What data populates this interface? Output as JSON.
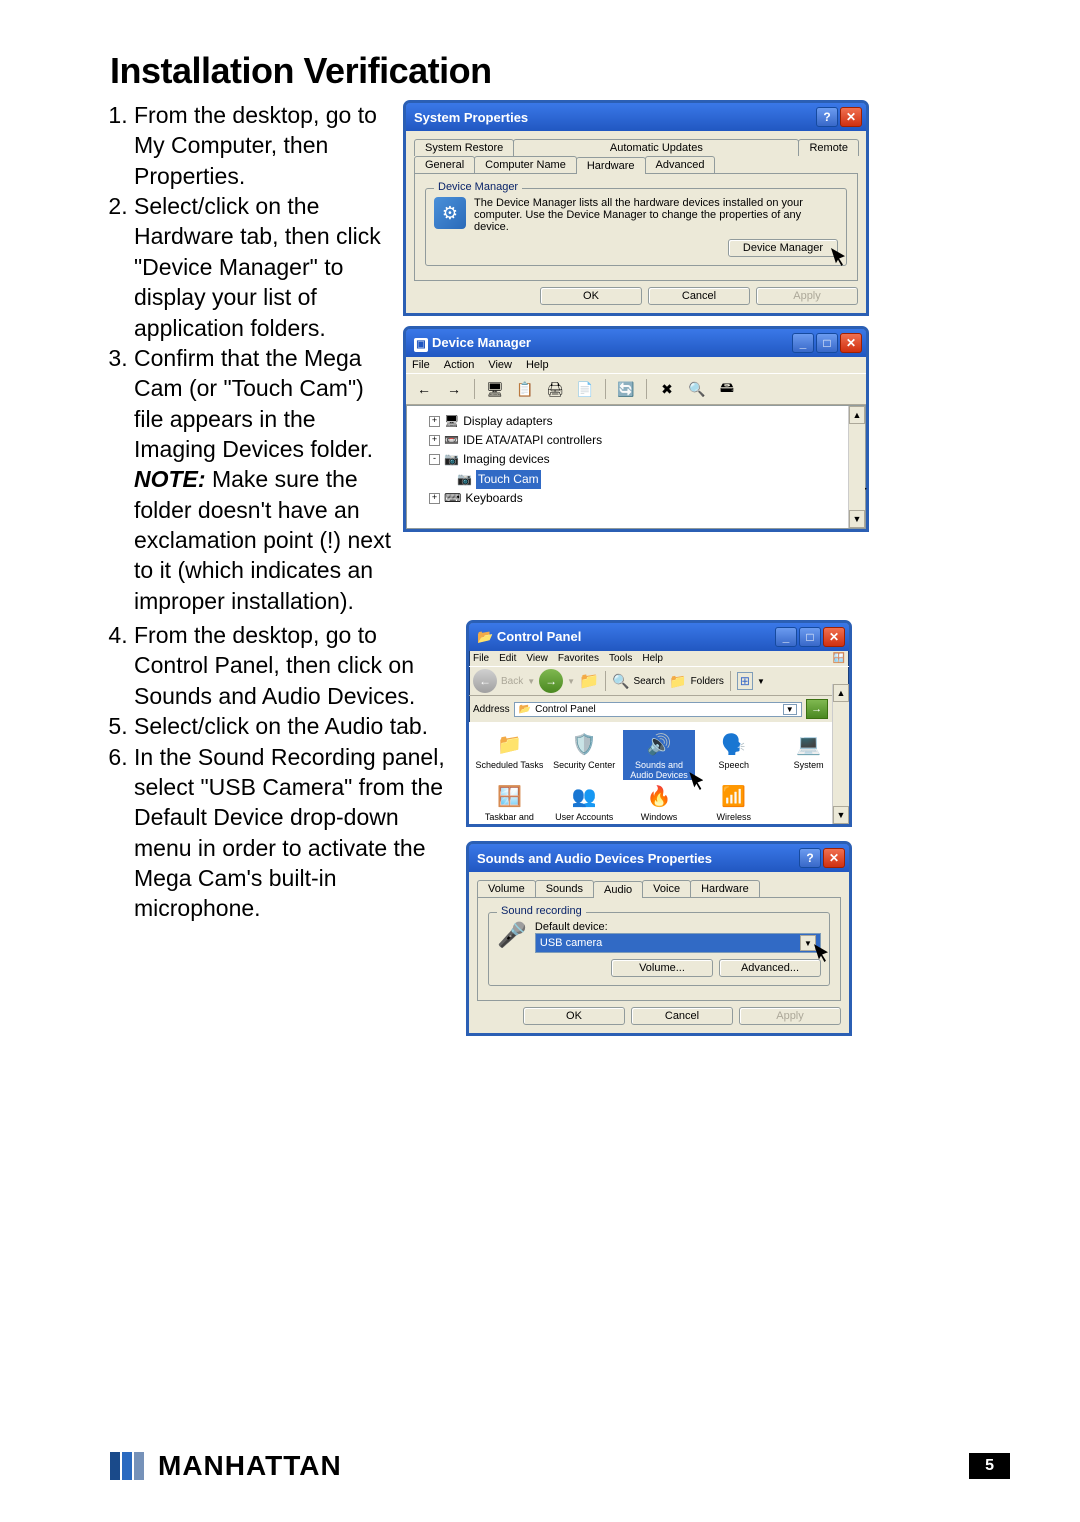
{
  "heading": "Installation Verification",
  "steps": [
    "From the desktop, go to My Computer, then Properties.",
    "Select/click on the Hardware tab, then click \"Device Manager\" to display your list of application folders.",
    "Confirm that the Mega Cam (or \"Touch Cam\") file appears in the Imaging Devices folder. ",
    "From the desktop, go to Control Panel, then click on Sounds and Audio Devices.",
    "Select/click on the Audio tab.",
    "In the Sound Recording panel, select \"USB Camera\" from the Default Device drop-down menu in order to activate the Mega Cam's built-in microphone."
  ],
  "note_label": "NOTE:",
  "note_text": " Make sure the folder doesn't have an exclamation point (!) next to it (which indicates an improper installation).",
  "sysprops": {
    "title": "System Properties",
    "tabs_top": [
      "System Restore",
      "Automatic Updates",
      "Remote"
    ],
    "tabs_bottom": [
      "General",
      "Computer Name",
      "Hardware",
      "Advanced"
    ],
    "active_tab": "Hardware",
    "group_title": "Device Manager",
    "group_text": "The Device Manager lists all the hardware devices installed on your computer. Use the Device Manager to change the properties of any device.",
    "dm_button": "Device Manager",
    "ok": "OK",
    "cancel": "Cancel",
    "apply": "Apply"
  },
  "devmgr": {
    "title": "Device Manager",
    "menu": [
      "File",
      "Action",
      "View",
      "Help"
    ],
    "tree": [
      {
        "indent": 1,
        "expand": "+",
        "label": "Display adapters"
      },
      {
        "indent": 1,
        "expand": "+",
        "label": "IDE ATA/ATAPI controllers"
      },
      {
        "indent": 1,
        "expand": "-",
        "label": "Imaging devices"
      },
      {
        "indent": 2,
        "expand": "",
        "label": "Touch Cam",
        "selected": true
      },
      {
        "indent": 1,
        "expand": "+",
        "label": "Keyboards"
      }
    ]
  },
  "cpanel": {
    "title": "Control Panel",
    "menu": [
      "File",
      "Edit",
      "View",
      "Favorites",
      "Tools",
      "Help"
    ],
    "back": "Back",
    "search": "Search",
    "folders": "Folders",
    "address_label": "Address",
    "address_value": "Control Panel",
    "go": "Go",
    "items_row1": [
      {
        "label": "Scheduled Tasks",
        "icon": "📁"
      },
      {
        "label": "Security Center",
        "icon": "🛡️"
      },
      {
        "label": "Sounds and Audio Devices",
        "icon": "🔊",
        "selected": true
      },
      {
        "label": "Speech",
        "icon": "🗣️"
      },
      {
        "label": "System",
        "icon": "💻"
      }
    ],
    "items_row2": [
      {
        "label": "Taskbar and",
        "icon": "🪟"
      },
      {
        "label": "User Accounts",
        "icon": "👥"
      },
      {
        "label": "Windows",
        "icon": "🔥"
      },
      {
        "label": "Wireless",
        "icon": "📶"
      }
    ]
  },
  "sounds": {
    "title": "Sounds and Audio Devices Properties",
    "tabs": [
      "Volume",
      "Sounds",
      "Audio",
      "Voice",
      "Hardware"
    ],
    "active_tab": "Audio",
    "group_title": "Sound recording",
    "default_label": "Default device:",
    "default_value": "USB camera",
    "volume_btn": "Volume...",
    "advanced_btn": "Advanced...",
    "ok": "OK",
    "cancel": "Cancel",
    "apply": "Apply"
  },
  "footer": {
    "brand": "MANHATTAN",
    "page": "5"
  }
}
